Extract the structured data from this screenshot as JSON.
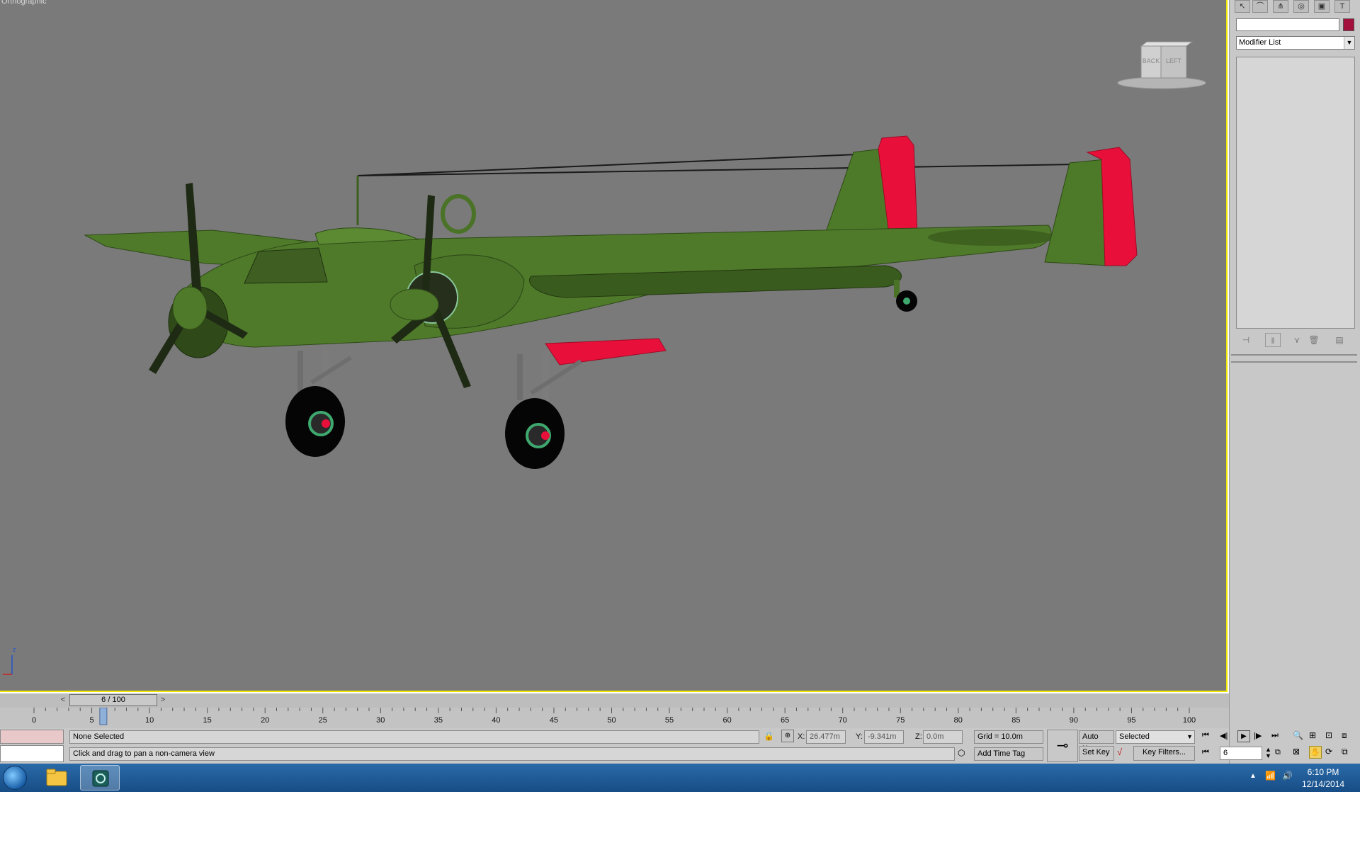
{
  "viewport": {
    "label": "Orthographic",
    "viewcube_faces": [
      "BACK",
      "LEFT"
    ],
    "axis_label": "z"
  },
  "command_panel": {
    "modifier_list_label": "Modifier List",
    "swatch_color": "#a3103b",
    "toolbar_icons": [
      "create-icon",
      "modify-icon",
      "hierarchy-icon",
      "motion-icon",
      "display-icon",
      "utilities-icon"
    ]
  },
  "timeline": {
    "slider_label": "6 / 100",
    "prev_arrow": "<",
    "next_arrow": ">",
    "ticks": [
      "0",
      "5",
      "10",
      "15",
      "20",
      "25",
      "30",
      "35",
      "40",
      "45",
      "50",
      "55",
      "60",
      "65",
      "70",
      "75",
      "80",
      "85",
      "90",
      "95",
      "100"
    ]
  },
  "status": {
    "selection": "None Selected",
    "prompt": "Click and drag to pan a non-camera view",
    "x_label": "X:",
    "x_value": "26.477m",
    "y_label": "Y:",
    "y_value": "-9.341m",
    "z_label": "Z:",
    "z_value": "0.0m",
    "grid": "Grid = 10.0m",
    "add_time_tag": "Add Time Tag",
    "auto_key": "Auto Key",
    "set_key": "Set Key",
    "key_mode": "Selected",
    "key_filters": "Key Filters...",
    "current_frame": "6"
  },
  "taskbar": {
    "time": "6:10 PM",
    "date": "12/14/2014"
  },
  "colors": {
    "model_green": "#4f7a2a",
    "model_red": "#e8103a",
    "viewport_border": "#f0e600"
  }
}
